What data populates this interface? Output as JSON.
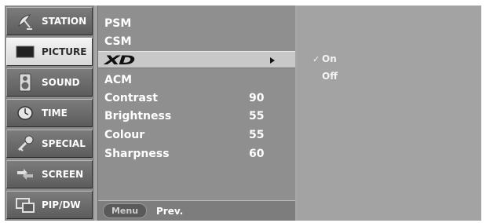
{
  "sidebar": {
    "items": [
      {
        "label": "STATION",
        "icon": "satellite-dish-icon"
      },
      {
        "label": "PICTURE",
        "icon": "picture-screen-icon",
        "selected": true
      },
      {
        "label": "SOUND",
        "icon": "speaker-icon"
      },
      {
        "label": "TIME",
        "icon": "clock-icon"
      },
      {
        "label": "SPECIAL",
        "icon": "key-icon"
      },
      {
        "label": "SCREEN",
        "icon": "screen-adjust-icon"
      },
      {
        "label": "PIP/DW",
        "icon": "pip-icon"
      }
    ]
  },
  "menu": {
    "items": [
      {
        "label": "PSM",
        "value": ""
      },
      {
        "label": "CSM",
        "value": ""
      },
      {
        "label": "XD",
        "value": "",
        "active": true
      },
      {
        "label": "ACM",
        "value": ""
      },
      {
        "label": "Contrast",
        "value": "90"
      },
      {
        "label": "Brightness",
        "value": "55"
      },
      {
        "label": "Colour",
        "value": "55"
      },
      {
        "label": "Sharpness",
        "value": "60"
      }
    ],
    "footer": {
      "button_label": "Menu",
      "action_label": "Prev."
    }
  },
  "options": {
    "items": [
      {
        "label": "On",
        "checked": true,
        "check_mark": "✓"
      },
      {
        "label": "Off",
        "checked": false,
        "check_mark": ""
      }
    ]
  },
  "colors": {
    "sidebar_bg": "#8a8a8a",
    "menu_bg": "#8f8f8f",
    "options_bg": "#a3a3a3",
    "highlight": "#c8c8c8"
  }
}
